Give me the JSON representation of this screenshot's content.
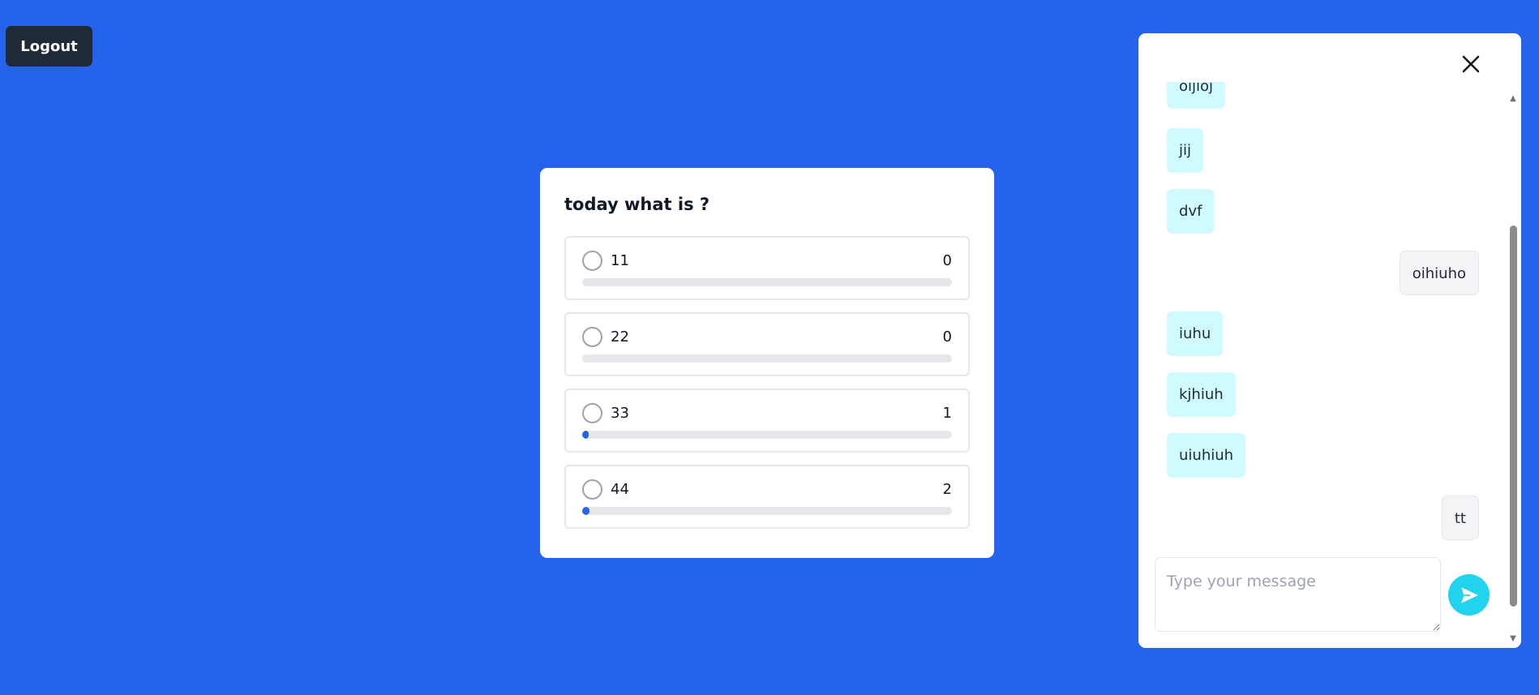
{
  "header": {
    "logout_label": "Logout"
  },
  "poll": {
    "question": "today what is ?",
    "options": [
      {
        "label": "11",
        "count": "0",
        "fraction": 0.0
      },
      {
        "label": "22",
        "count": "0",
        "fraction": 0.0
      },
      {
        "label": "33",
        "count": "1",
        "fraction": 0.01
      },
      {
        "label": "44",
        "count": "2",
        "fraction": 0.02
      }
    ]
  },
  "chat": {
    "close_icon": "close-icon",
    "messages": [
      {
        "text": "oijioj",
        "sender": "other"
      },
      {
        "text": "jij",
        "sender": "other"
      },
      {
        "text": "dvf",
        "sender": "other"
      },
      {
        "text": "oihiuho",
        "sender": "me"
      },
      {
        "text": "iuhu",
        "sender": "other"
      },
      {
        "text": "kjhiuh",
        "sender": "other"
      },
      {
        "text": "uiuhiuh",
        "sender": "other"
      },
      {
        "text": "tt",
        "sender": "me"
      }
    ],
    "input_placeholder": "Type your message",
    "send_icon": "send-icon"
  },
  "colors": {
    "background": "#2563eb",
    "received_bubble": "#cffafe",
    "sent_bubble": "#f3f4f6",
    "send_button": "#22d3ee",
    "bar_fill": "#2563eb"
  }
}
